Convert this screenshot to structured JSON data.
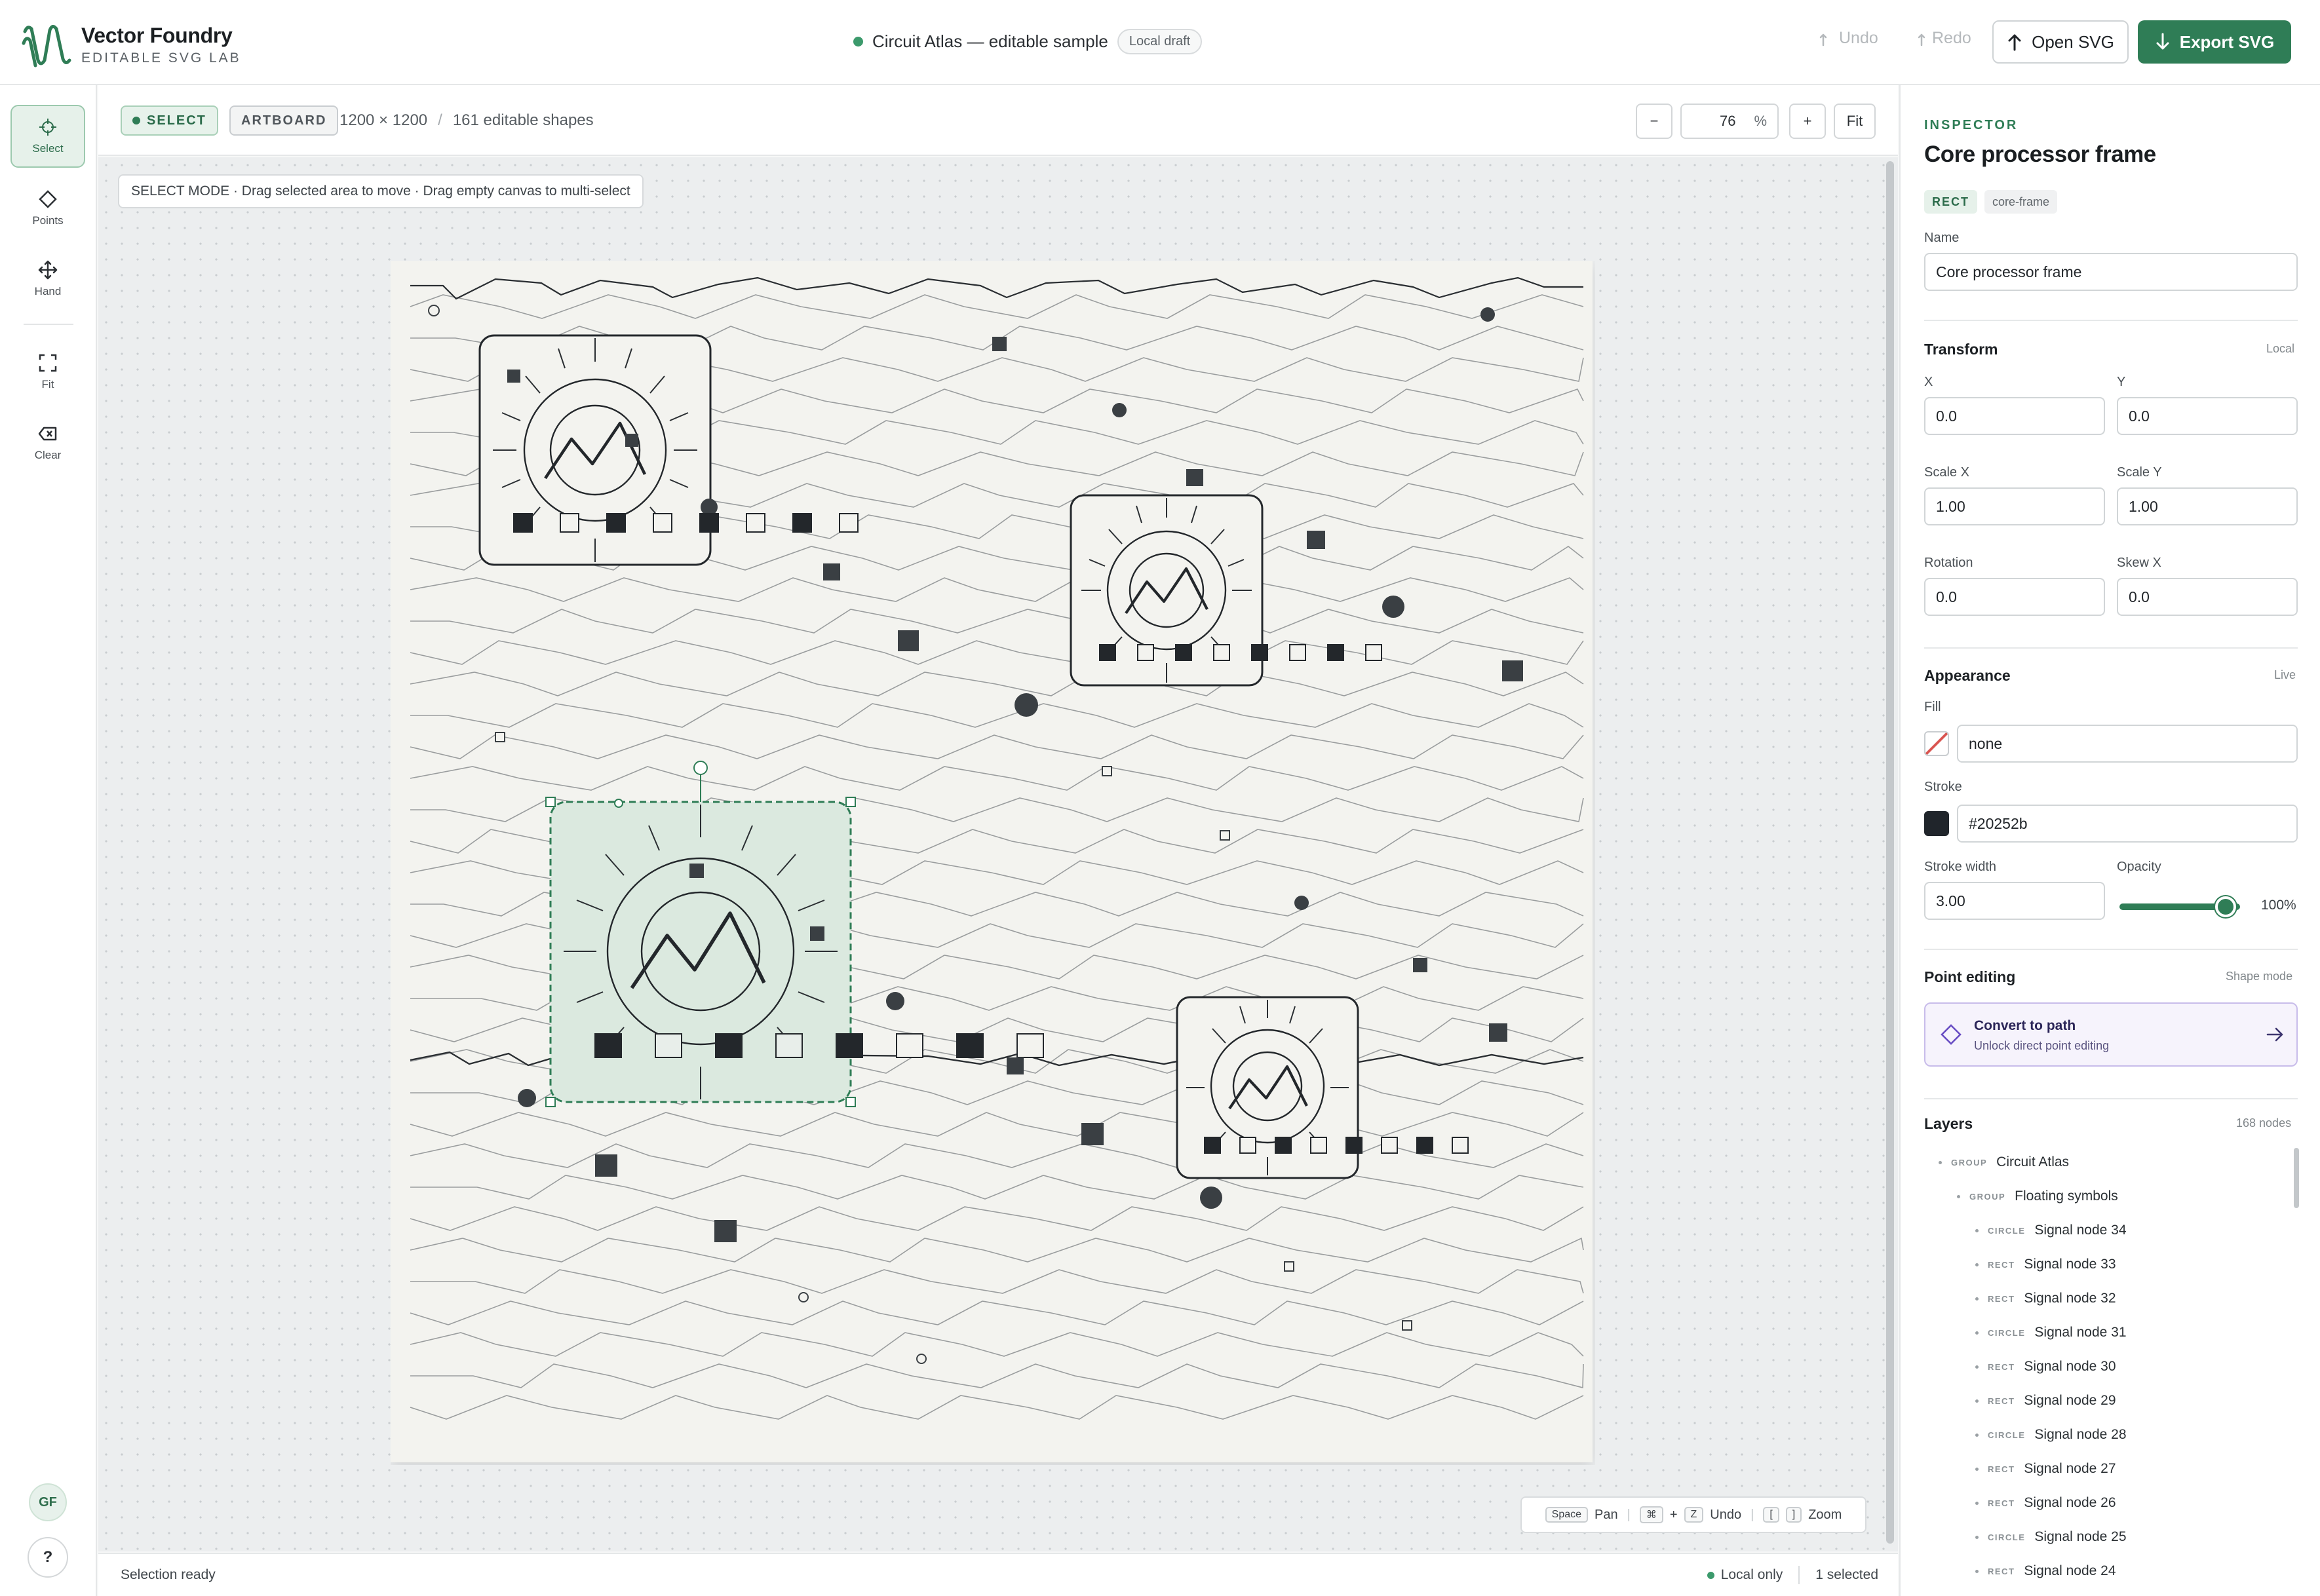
{
  "app": {
    "name": "Vector Foundry",
    "subtitle": "EDITABLE SVG LAB",
    "document_title": "Circuit Atlas — editable sample",
    "draft_badge": "Local draft",
    "undo_label": "Undo",
    "redo_label": "Redo",
    "open_label": "Open SVG",
    "export_label": "Export SVG"
  },
  "tools": {
    "select": "Select",
    "points": "Points",
    "hand": "Hand",
    "fit": "Fit",
    "clear": "Clear",
    "avatar_initials": "GF",
    "help": "?"
  },
  "canvas_header": {
    "mode_select": "SELECT",
    "mode_artboard": "ARTBOARD",
    "dimensions": "1200 × 1200",
    "separator": "/",
    "shape_count": "161 editable shapes",
    "zoom_out": "−",
    "zoom_value": "76",
    "zoom_unit": "%",
    "zoom_in": "+",
    "fit_label": "Fit"
  },
  "canvas": {
    "mode_hint": "SELECT MODE · Drag selected area to move · Drag empty canvas to multi-select",
    "shortcuts": {
      "space_key": "Space",
      "pan_label": "Pan",
      "cmd_key": "⌘",
      "plus": "+",
      "z_key": "Z",
      "undo_label": "Undo",
      "bracket_open": "[",
      "bracket_close": "]",
      "zoom_label": "Zoom"
    }
  },
  "statusbar": {
    "left": "Selection ready",
    "local": "Local only",
    "selected": "1 selected"
  },
  "inspector": {
    "kicker": "INSPECTOR",
    "title": "Core processor frame",
    "type_tag": "RECT",
    "id_tag": "core-frame",
    "name_label": "Name",
    "name_value": "Core processor frame",
    "transform": {
      "title": "Transform",
      "aside": "Local",
      "x_label": "X",
      "x_value": "0.0",
      "y_label": "Y",
      "y_value": "0.0",
      "scale_x_label": "Scale X",
      "scale_x_value": "1.00",
      "scale_y_label": "Scale Y",
      "scale_y_value": "1.00",
      "rotation_label": "Rotation",
      "rotation_value": "0.0",
      "skew_x_label": "Skew X",
      "skew_x_value": "0.0"
    },
    "appearance": {
      "title": "Appearance",
      "aside": "Live",
      "fill_label": "Fill",
      "fill_value": "none",
      "stroke_label": "Stroke",
      "stroke_value": "#20252b",
      "stroke_width_label": "Stroke width",
      "stroke_width_value": "3.00",
      "opacity_label": "Opacity",
      "opacity_value": "100%",
      "opacity_fraction": 0.94
    },
    "point_editing": {
      "title": "Point editing",
      "aside": "Shape mode",
      "convert_title": "Convert to path",
      "convert_sub": "Unlock direct point editing"
    },
    "layers": {
      "title": "Layers",
      "count": "168 nodes",
      "items": [
        {
          "type": "GROUP",
          "name": "Circuit Atlas"
        },
        {
          "type": "GROUP",
          "name": "Floating symbols"
        },
        {
          "type": "CIRCLE",
          "name": "Signal node 34"
        },
        {
          "type": "RECT",
          "name": "Signal node 33"
        },
        {
          "type": "RECT",
          "name": "Signal node 32"
        },
        {
          "type": "CIRCLE",
          "name": "Signal node 31"
        },
        {
          "type": "RECT",
          "name": "Signal node 30"
        },
        {
          "type": "RECT",
          "name": "Signal node 29"
        },
        {
          "type": "CIRCLE",
          "name": "Signal node 28"
        },
        {
          "type": "RECT",
          "name": "Signal node 27"
        },
        {
          "type": "RECT",
          "name": "Signal node 26"
        },
        {
          "type": "CIRCLE",
          "name": "Signal node 25"
        },
        {
          "type": "RECT",
          "name": "Signal node 24"
        }
      ]
    }
  },
  "colors": {
    "accent": "#2f7d56",
    "stroke": "#20252b",
    "artboard": "#f3f3ef",
    "selection_fill": "#dbe9df",
    "convert_accent": "#6a4fc4"
  }
}
